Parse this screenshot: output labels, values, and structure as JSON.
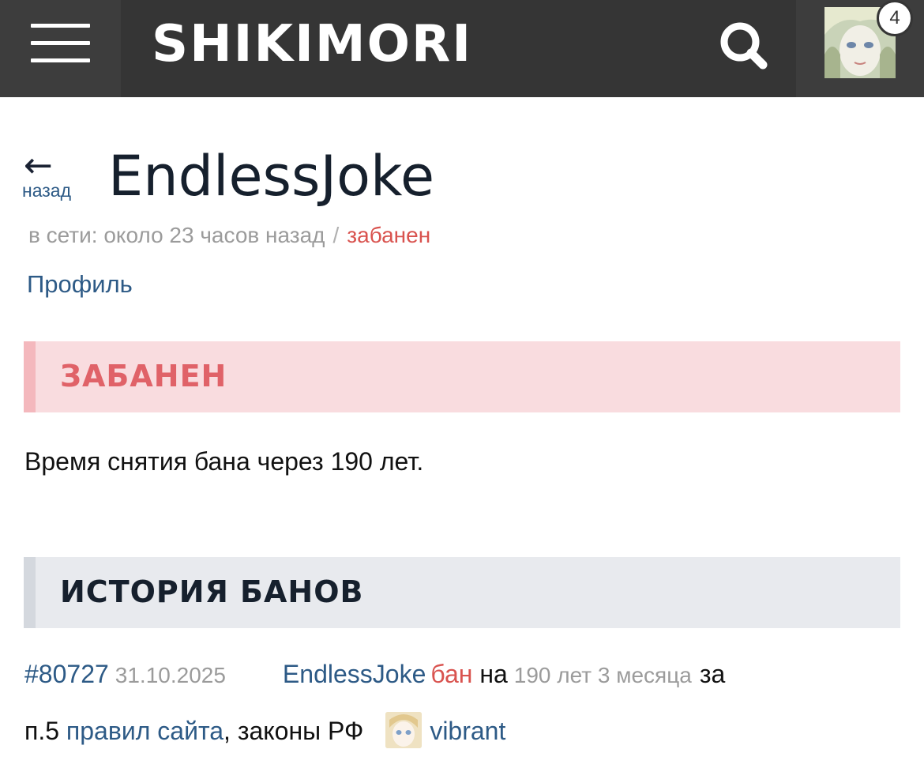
{
  "topbar": {
    "logo": "SHIKIMORI",
    "notifications_count": "4",
    "icons": {
      "menu": "hamburger-menu-icon",
      "search": "search-icon"
    }
  },
  "header": {
    "back_label": "назад",
    "back_arrow": "←",
    "username": "EndlessJoke",
    "online_status": "в сети: около 23 часов назад",
    "separator": "/",
    "ban_status": "забанен",
    "profile_link": "Профиль"
  },
  "ban_section": {
    "title": "ЗАБАНЕН",
    "unban_text": "Время снятия бана через 190 лет."
  },
  "history": {
    "title": "ИСТОРИЯ БАНОВ",
    "entries": [
      {
        "id": "#80727",
        "date": "31.10.2025",
        "user": "EndlessJoke",
        "action": "бан",
        "prep_na": "на",
        "duration": "190 лет 3 месяца",
        "prep_za": "за",
        "reason_prefix": "п.5",
        "rules_link": "правил сайта",
        "reason_suffix": ", законы РФ",
        "moderator": "vibrant"
      }
    ]
  },
  "colors": {
    "topbar": "#353535",
    "link": "#2d5a86",
    "banned": "#d9534f",
    "ban_box_bg": "#f9dcdf",
    "history_box_bg": "#e8eaee"
  }
}
